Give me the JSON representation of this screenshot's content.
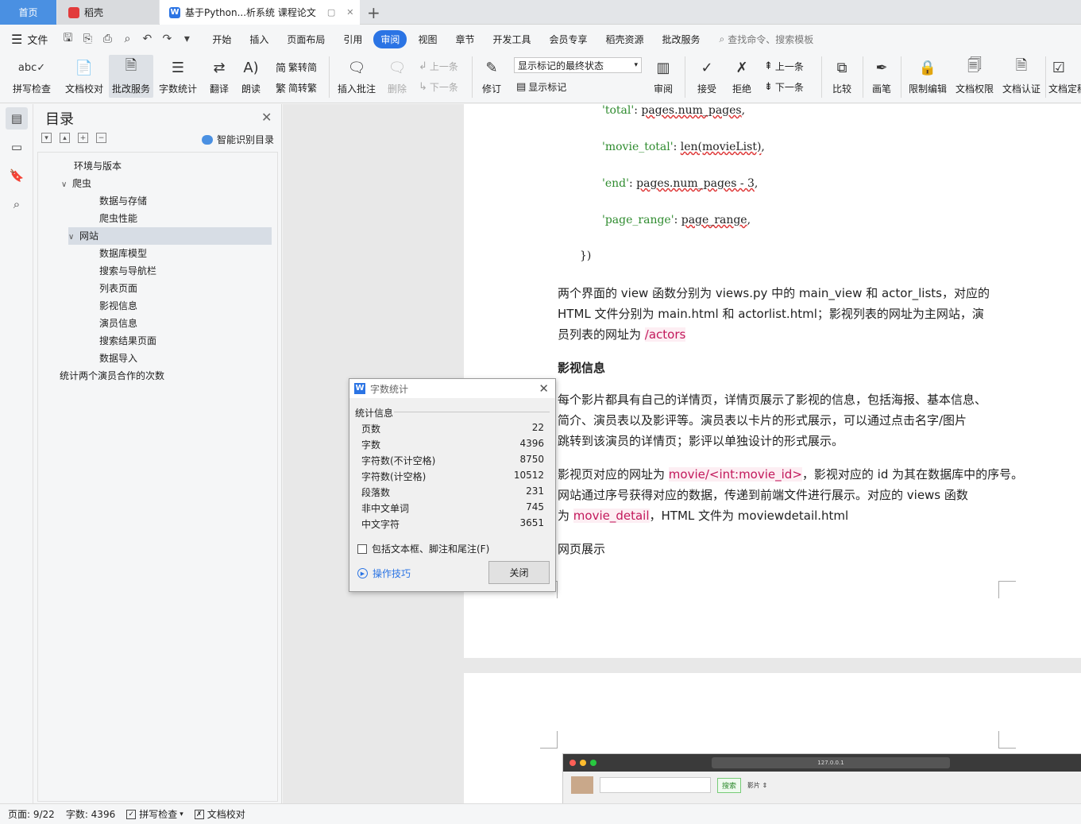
{
  "tabs": {
    "home": "首页",
    "daoke": "稻壳",
    "doc": "基于Python...析系统 课程论文",
    "add": "+"
  },
  "menu": {
    "file": "文件",
    "items": [
      "开始",
      "插入",
      "页面布局",
      "引用",
      "审阅",
      "视图",
      "章节",
      "开发工具",
      "会员专享",
      "稻壳资源",
      "批改服务"
    ],
    "active": "审阅",
    "search": "查找命令、搜索模板"
  },
  "ribbon": {
    "spell": "拼写检查",
    "proof": "文档校对",
    "review_service": "批改服务",
    "word_count": "字数统计",
    "translate": "翻译",
    "read": "朗读",
    "trad_to_simp": "繁转简",
    "simp_to_trad": "简转繁",
    "insert_comment": "插入批注",
    "delete": "删除",
    "prev_comment": "上一条",
    "next_comment": "下一条",
    "revise": "修订",
    "show_markup_select": "显示标记的最终状态",
    "show_markup": "显示标记",
    "review": "审阅",
    "accept": "接受",
    "reject": "拒绝",
    "prev": "上一条",
    "next": "下一条",
    "compare": "比较",
    "pen": "画笔",
    "restrict_edit": "限制编辑",
    "doc_permission": "文档权限",
    "doc_cert": "文档认证",
    "doc_final": "文档定稿"
  },
  "toc": {
    "title": "目录",
    "smart": "智能识别目录",
    "items": [
      {
        "label": "环境与版本",
        "level": 1,
        "arrow": ""
      },
      {
        "label": "爬虫",
        "level": 1,
        "arrow": "∨"
      },
      {
        "label": "数据与存储",
        "level": 2,
        "arrow": ""
      },
      {
        "label": "爬虫性能",
        "level": 2,
        "arrow": ""
      },
      {
        "label": "网站",
        "level": 1,
        "arrow": "∨"
      },
      {
        "label": "数据库模型",
        "level": 2,
        "arrow": ""
      },
      {
        "label": "搜索与导航栏",
        "level": 2,
        "arrow": ""
      },
      {
        "label": "列表页面",
        "level": 2,
        "arrow": ""
      },
      {
        "label": "影视信息",
        "level": 2,
        "arrow": ""
      },
      {
        "label": "演员信息",
        "level": 2,
        "arrow": ""
      },
      {
        "label": "搜索结果页面",
        "level": 2,
        "arrow": ""
      },
      {
        "label": "数据导入",
        "level": 2,
        "arrow": ""
      },
      {
        "label": "统计两个演员合作的次数",
        "level": 0,
        "arrow": ""
      }
    ],
    "selected_index": 4
  },
  "document": {
    "code_lines": [
      {
        "key": "'total'",
        "sep": ": ",
        "value": "pages.num_pages",
        "end": ","
      },
      {
        "key": "'movie_total'",
        "sep": ": ",
        "value": "len(movieList)",
        "end": ","
      },
      {
        "key": "'end'",
        "sep": ": ",
        "value": "pages.num_pages - 3",
        "end": ","
      },
      {
        "key": "'page_range'",
        "sep": ": ",
        "value": "page_range",
        "end": ","
      }
    ],
    "code_close": "})",
    "p1_line1": "两个界面的 view 函数分别为 views.py 中的 main_view 和 actor_lists，对应的",
    "p1_line2": "HTML 文件分别为 main.html 和 actorlist.html；影视列表的网址为主网站，演",
    "p1_line3_a": "员列表的网址为 ",
    "p1_line3_link": "/actors",
    "heading": "影视信息",
    "p2_line1": "每个影片都具有自己的详情页，详情页展示了影视的信息，包括海报、基本信息、",
    "p2_line2": "简介、演员表以及影评等。演员表以卡片的形式展示，可以通过点击名字/图片",
    "p2_line3": "跳转到该演员的详情页；影评以单独设计的形式展示。",
    "p3_line1_a": "影视页对应的网址为 ",
    "p3_line1_link": "movie/<int:movie_id>",
    "p3_line1_b": "，影视对应的 id 为其在数据库中的序号。",
    "p3_line2": "网站通过序号获得对应的数据，传递到前端文件进行展示。对应的 views 函数",
    "p3_line3_a": "为 ",
    "p3_line3_link": "movie_detail",
    "p3_line3_b": "，HTML 文件为 moviewdetail.html",
    "p4": "网页展示",
    "shot_url": "127.0.0.1",
    "shot_search": "搜索",
    "shot_select": "影片 ⇕"
  },
  "dialog": {
    "title": "字数统计",
    "section": "统计信息",
    "rows": [
      {
        "label": "页数",
        "value": "22"
      },
      {
        "label": "字数",
        "value": "4396"
      },
      {
        "label": "字符数(不计空格)",
        "value": "8750"
      },
      {
        "label": "字符数(计空格)",
        "value": "10512"
      },
      {
        "label": "段落数",
        "value": "231"
      },
      {
        "label": "非中文单词",
        "value": "745"
      },
      {
        "label": "中文字符",
        "value": "3651"
      }
    ],
    "checkbox": "包括文本框、脚注和尾注(F)",
    "tips": "操作技巧",
    "close": "关闭"
  },
  "status": {
    "page": "页面: 9/22",
    "words": "字数: 4396",
    "spell": "拼写检查",
    "proof": "文档校对"
  }
}
